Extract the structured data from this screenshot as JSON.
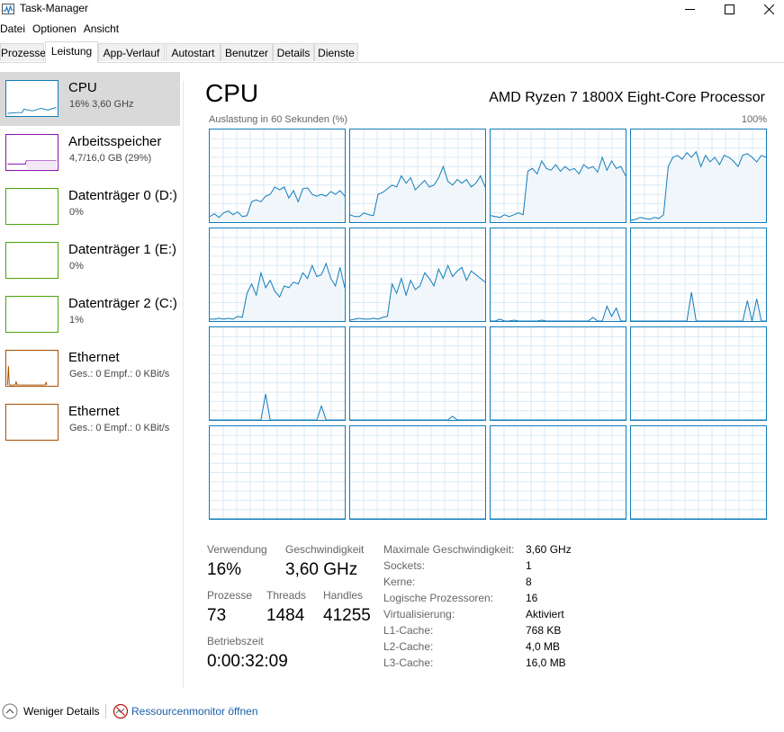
{
  "window": {
    "title": "Task-Manager",
    "app_icon": "task-manager-icon",
    "controls": [
      "minimize-icon",
      "maximize-icon",
      "close-icon"
    ]
  },
  "menu": [
    "Datei",
    "Optionen",
    "Ansicht"
  ],
  "tabs": [
    {
      "label": "Prozesse"
    },
    {
      "label": "Leistung",
      "active": true
    },
    {
      "label": "App-Verlauf"
    },
    {
      "label": "Autostart"
    },
    {
      "label": "Benutzer"
    },
    {
      "label": "Details"
    },
    {
      "label": "Dienste"
    }
  ],
  "sidebar": {
    "items": [
      {
        "title": "CPU",
        "subtitle": "16% 3,60 GHz",
        "color": "#117dbb",
        "active": true
      },
      {
        "title": "Arbeitsspeicher",
        "subtitle": "4,7/16,0 GB (29%)",
        "color": "#8b12ae"
      },
      {
        "title": "Datenträger 0 (D:)",
        "subtitle": "0%",
        "color": "#4da60c"
      },
      {
        "title": "Datenträger 1 (E:)",
        "subtitle": "0%",
        "color": "#4da60c"
      },
      {
        "title": "Datenträger 2 (C:)",
        "subtitle": "1%",
        "color": "#4da60c"
      },
      {
        "title": "Ethernet",
        "subtitle": "Ges.: 0 Empf.: 0 KBit/s",
        "color": "#a74f01"
      },
      {
        "title": "Ethernet",
        "subtitle": "Ges.: 0 Empf.: 0 KBit/s",
        "color": "#a74f01"
      }
    ]
  },
  "main": {
    "title": "CPU",
    "model": "AMD Ryzen 7 1800X Eight-Core Processor",
    "graph_label": "Auslastung in 60 Sekunden (%)",
    "graph_max": "100%",
    "accent_color": "#117dbb",
    "grid_color": "#d9eaf4",
    "fill_color": "#f1f6fa"
  },
  "core_graphs": {
    "level_scale_max": 100,
    "cores": [
      [
        6,
        9,
        5,
        10,
        12,
        8,
        11,
        6,
        7,
        22,
        24,
        22,
        28,
        30,
        38,
        35,
        38,
        26,
        34,
        22,
        36,
        37,
        30,
        28,
        30,
        28,
        33,
        30,
        34,
        28
      ],
      [
        8,
        6,
        6,
        10,
        8,
        7,
        30,
        32,
        36,
        40,
        38,
        50,
        42,
        48,
        35,
        40,
        45,
        38,
        40,
        48,
        60,
        44,
        40,
        46,
        42,
        46,
        38,
        42,
        50,
        38
      ],
      [
        7,
        6,
        5,
        8,
        6,
        8,
        10,
        8,
        55,
        58,
        52,
        66,
        58,
        56,
        62,
        55,
        60,
        56,
        58,
        52,
        62,
        58,
        60,
        54,
        70,
        56,
        66,
        58,
        60,
        50
      ],
      [
        2,
        3,
        5,
        4,
        3,
        5,
        4,
        8,
        60,
        70,
        72,
        68,
        75,
        70,
        76,
        60,
        72,
        65,
        70,
        62,
        72,
        70,
        66,
        60,
        72,
        74,
        70,
        65,
        72,
        70
      ],
      [
        2,
        2,
        3,
        2,
        3,
        2,
        5,
        4,
        30,
        40,
        28,
        52,
        36,
        44,
        32,
        26,
        38,
        36,
        42,
        40,
        52,
        46,
        60,
        48,
        50,
        62,
        46,
        38,
        58,
        36
      ],
      [
        1,
        2,
        3,
        2,
        2,
        3,
        2,
        4,
        5,
        40,
        30,
        46,
        28,
        44,
        34,
        38,
        52,
        46,
        38,
        56,
        46,
        60,
        48,
        54,
        58,
        44,
        54,
        50,
        46,
        42
      ],
      [
        0,
        0,
        2,
        0,
        0,
        1,
        0,
        0,
        0,
        0,
        0,
        1,
        0,
        0,
        0,
        0,
        0,
        0,
        0,
        0,
        0,
        0,
        4,
        0,
        0,
        16,
        5,
        14,
        0,
        0
      ],
      [
        0,
        0,
        0,
        0,
        0,
        0,
        0,
        0,
        0,
        0,
        0,
        0,
        0,
        31,
        0,
        0,
        0,
        0,
        0,
        0,
        0,
        0,
        0,
        0,
        0,
        22,
        0,
        24,
        0,
        0
      ],
      [
        0,
        0,
        0,
        0,
        0,
        0,
        0,
        0,
        0,
        0,
        0,
        0,
        28,
        0,
        0,
        0,
        0,
        0,
        0,
        0,
        0,
        0,
        0,
        0,
        15,
        0,
        0,
        0,
        0,
        0
      ],
      [
        0,
        0,
        0,
        0,
        0,
        0,
        0,
        0,
        0,
        0,
        0,
        0,
        0,
        0,
        0,
        0,
        0,
        0,
        0,
        0,
        0,
        0,
        4,
        0,
        0,
        0,
        0,
        0,
        0,
        0
      ],
      [
        0,
        0,
        0,
        0,
        0,
        0,
        0,
        0,
        0,
        0,
        0,
        0,
        0,
        0,
        0,
        0,
        0,
        0,
        0,
        0,
        0,
        0,
        0,
        0,
        0,
        0,
        0,
        0,
        0,
        0
      ],
      [
        0,
        0,
        0,
        0,
        0,
        0,
        0,
        0,
        0,
        0,
        0,
        0,
        0,
        0,
        0,
        0,
        0,
        0,
        0,
        0,
        0,
        0,
        0,
        0,
        0,
        0,
        0,
        0,
        0,
        0
      ],
      [
        0,
        0,
        0,
        0,
        0,
        0,
        0,
        0,
        0,
        0,
        0,
        0,
        0,
        0,
        0,
        0,
        0,
        0,
        0,
        0,
        0,
        0,
        0,
        0,
        0,
        0,
        0,
        0,
        0,
        0
      ],
      [
        0,
        0,
        0,
        0,
        0,
        0,
        0,
        0,
        0,
        0,
        0,
        0,
        0,
        0,
        0,
        0,
        0,
        0,
        0,
        0,
        0,
        0,
        0,
        0,
        0,
        0,
        0,
        0,
        0,
        0
      ],
      [
        0,
        0,
        0,
        0,
        0,
        0,
        0,
        0,
        0,
        0,
        0,
        0,
        0,
        0,
        0,
        0,
        0,
        0,
        0,
        0,
        0,
        0,
        0,
        0,
        0,
        0,
        0,
        0,
        0,
        0
      ],
      [
        0,
        0,
        0,
        0,
        0,
        0,
        0,
        0,
        0,
        0,
        0,
        0,
        0,
        0,
        0,
        0,
        0,
        0,
        0,
        0,
        0,
        0,
        0,
        0,
        0,
        0,
        0,
        0,
        0,
        0
      ]
    ]
  },
  "stats": {
    "verwendung": {
      "label": "Verwendung",
      "value": "16%"
    },
    "geschwindigkeit": {
      "label": "Geschwindigkeit",
      "value": "3,60 GHz"
    },
    "prozesse": {
      "label": "Prozesse",
      "value": "73"
    },
    "threads": {
      "label": "Threads",
      "value": "1484"
    },
    "handles": {
      "label": "Handles",
      "value": "41255"
    },
    "betriebszeit": {
      "label": "Betriebszeit",
      "value": "0:00:32:09"
    }
  },
  "specs": [
    {
      "label": "Maximale Geschwindigkeit:",
      "value": "3,60 GHz"
    },
    {
      "label": "Sockets:",
      "value": "1"
    },
    {
      "label": "Kerne:",
      "value": "8"
    },
    {
      "label": "Logische Prozessoren:",
      "value": "16"
    },
    {
      "label": "Virtualisierung:",
      "value": "Aktiviert"
    },
    {
      "label": "L1-Cache:",
      "value": "768 KB"
    },
    {
      "label": "L2-Cache:",
      "value": "4,0 MB"
    },
    {
      "label": "L3-Cache:",
      "value": "16,0 MB"
    }
  ],
  "footer": {
    "fewer_details": "Weniger Details",
    "fewer_details_icon": "chevron-up-circle-icon",
    "resource_monitor": "Ressourcenmonitor öffnen",
    "resource_monitor_icon": "resource-monitor-icon",
    "link_color": "#1a5ea6"
  }
}
